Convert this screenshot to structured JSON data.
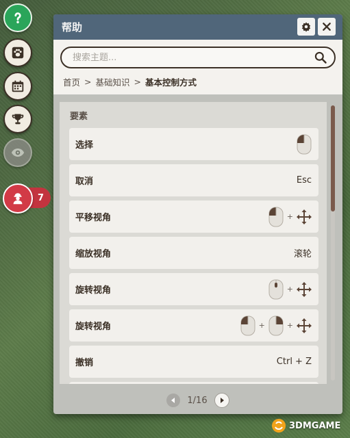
{
  "panel": {
    "title": "帮助",
    "search_placeholder": "搜索主题...",
    "breadcrumb": {
      "home": "首页",
      "sep1": ">",
      "section": "基础知识",
      "sep2": ">",
      "current": "基本控制方式"
    },
    "section_label": "要素",
    "rows": [
      {
        "label": "选择",
        "value": ""
      },
      {
        "label": "取消",
        "value": "Esc"
      },
      {
        "label": "平移视角",
        "value": ""
      },
      {
        "label": "缩放视角",
        "value": "滚轮"
      },
      {
        "label": "旋转视角",
        "value": ""
      },
      {
        "label": "旋转视角",
        "value": ""
      },
      {
        "label": "撤销",
        "value": "Ctrl + Z"
      }
    ],
    "plus": "+",
    "pager": {
      "text": "1/16"
    }
  },
  "rail": {
    "badge_count": "7",
    "icons": [
      "question-icon",
      "paw-icon",
      "calendar-icon",
      "trophy-icon",
      "eye-icon",
      "zookeeper-icon"
    ]
  },
  "watermark": {
    "text": "3DMGAME"
  },
  "colors": {
    "titlebar": "#50667a",
    "accent_red": "#d23a46",
    "accent_green": "#2aa55a",
    "text_dark": "#3b3026",
    "scroll_thumb": "#7a5a4c"
  }
}
